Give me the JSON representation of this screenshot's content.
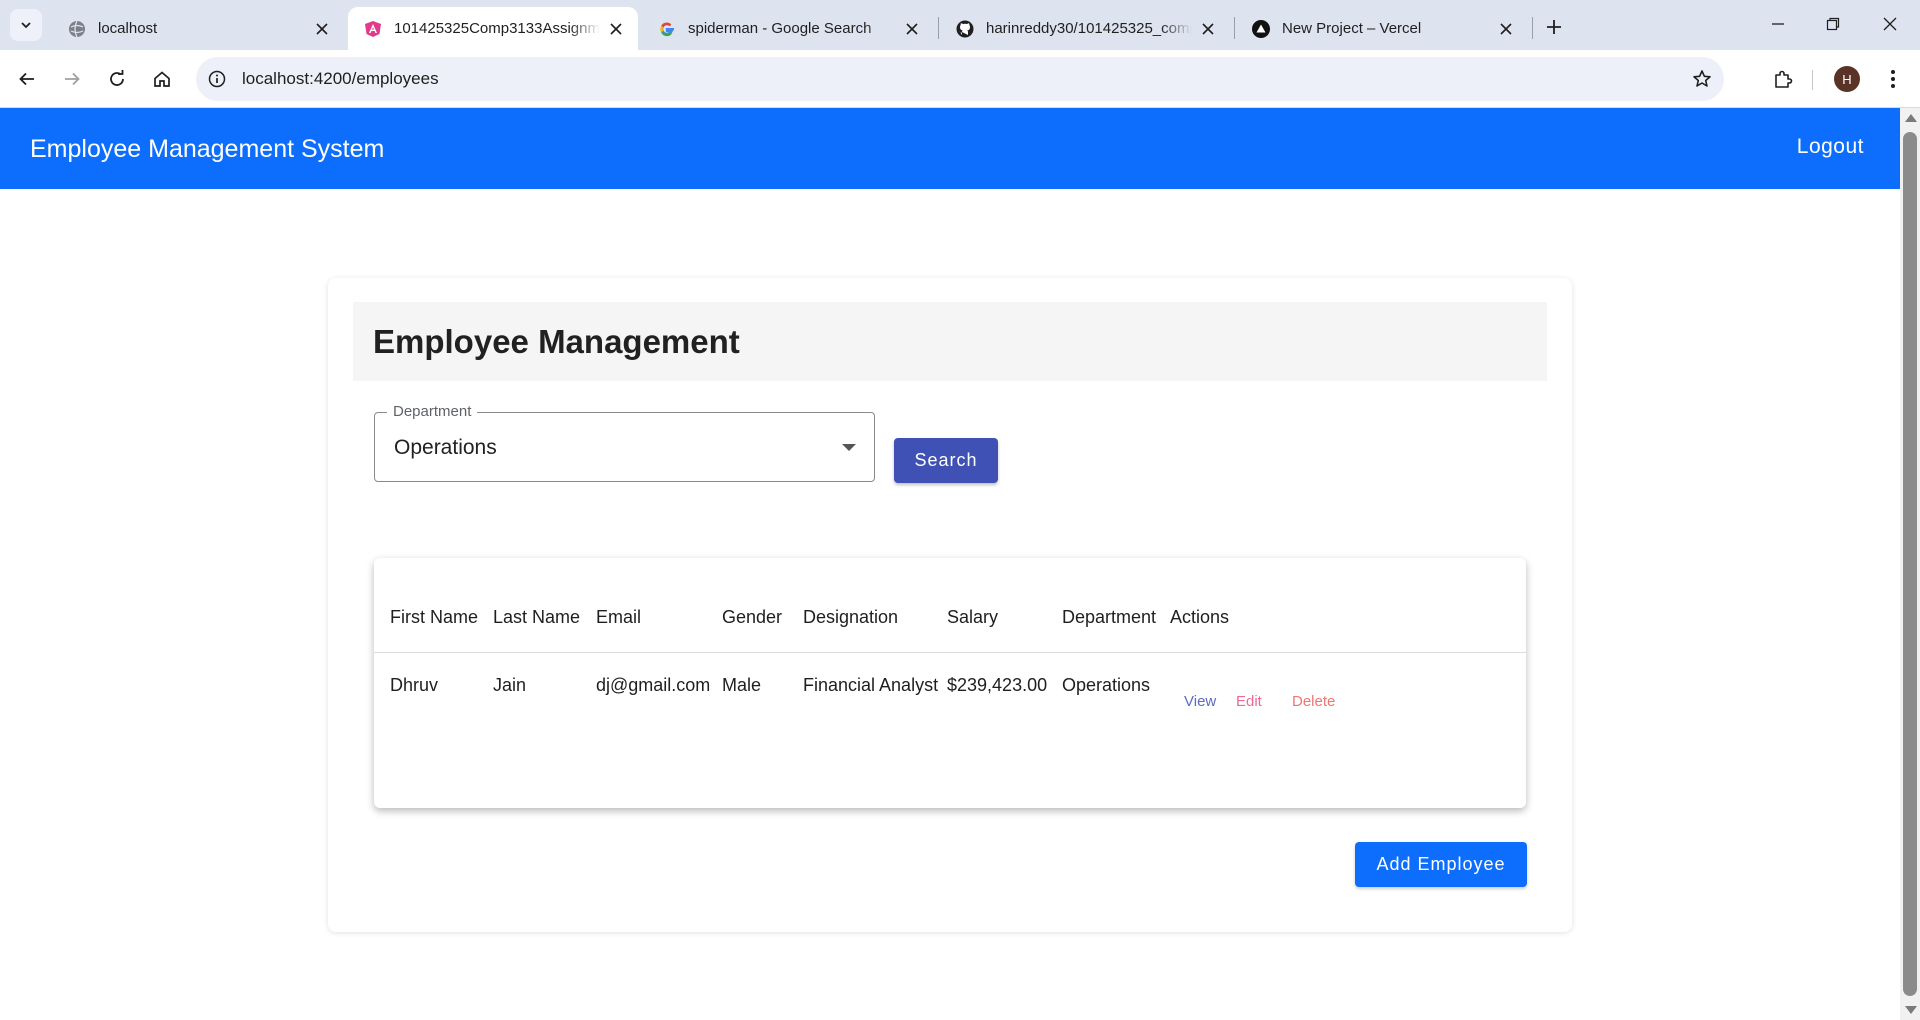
{
  "browser": {
    "tabs": [
      {
        "title": "localhost",
        "favicon": "globe-icon",
        "active": false
      },
      {
        "title": "101425325Comp3133Assignment",
        "favicon": "angular-icon",
        "active": true
      },
      {
        "title": "spiderman - Google Search",
        "favicon": "google-icon",
        "active": false
      },
      {
        "title": "harinreddy30/101425325_comp3133",
        "favicon": "github-icon",
        "active": false
      },
      {
        "title": "New Project – Vercel",
        "favicon": "vercel-icon",
        "active": false
      }
    ],
    "url": "localhost:4200/employees",
    "profile_initial": "H"
  },
  "app": {
    "brand": "Employee Management System",
    "logout": "Logout",
    "accent_color": "#0d6efd"
  },
  "page": {
    "title": "Employee Management",
    "department_filter": {
      "label": "Department",
      "value": "Operations"
    },
    "search_label": "Search",
    "add_label": "Add Employee",
    "search_color": "#3f51b5"
  },
  "table": {
    "headers": [
      "First Name",
      "Last Name",
      "Email",
      "Gender",
      "Designation",
      "Salary",
      "Department",
      "Actions"
    ],
    "rows": [
      {
        "first_name": "Dhruv",
        "last_name": "Jain",
        "email": "dj@gmail.com",
        "gender": "Male",
        "designation": "Financial Analyst",
        "salary": "$239,423.00",
        "department": "Operations"
      }
    ],
    "actions": {
      "view": "View",
      "edit": "Edit",
      "delete": "Delete",
      "view_color": "#5c6bc0",
      "edit_color": "#ec6a99",
      "delete_color": "#f07575"
    }
  }
}
